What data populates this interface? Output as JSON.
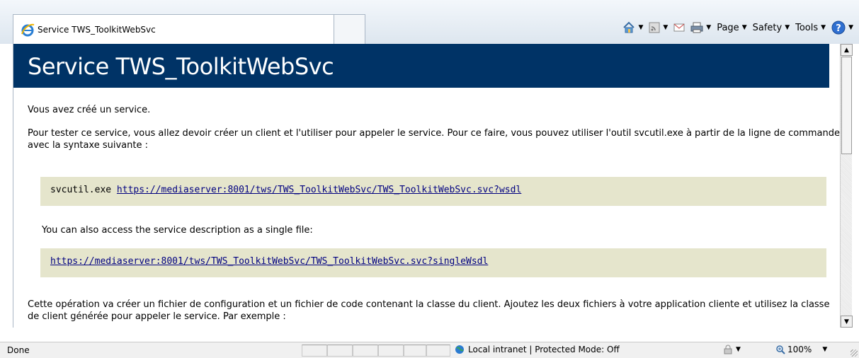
{
  "tab": {
    "title": "Service TWS_ToolkitWebSvc"
  },
  "command_bar": {
    "home_icon": "home-icon",
    "feeds_icon": "feeds-icon",
    "mail_icon": "mail-icon",
    "print_icon": "print-icon",
    "page_label": "Page",
    "safety_label": "Safety",
    "tools_label": "Tools",
    "help_icon": "help-icon"
  },
  "content": {
    "heading": "Service TWS_ToolkitWebSvc",
    "created_text": "Vous avez créé un service.",
    "instructions": "Pour tester ce service, vous allez devoir créer un client et l'utiliser pour appeler le service. Pour ce faire, vous pouvez utiliser l'outil svcutil.exe à partir de la ligne de commande avec la syntaxe suivante :",
    "svcutil_cmd": "svcutil.exe ",
    "wsdl_link": "https://mediaserver:8001/tws/TWS_ToolkitWebSvc/TWS_ToolkitWebSvc.svc?wsdl",
    "single_file_text": "You can also access the service description as a single file:",
    "single_wsdl_link": "https://mediaserver:8001/tws/TWS_ToolkitWebSvc/TWS_ToolkitWebSvc.svc?singleWsdl",
    "config_text": "Cette opération va créer un fichier de configuration et un fichier de code contenant la classe du client. Ajoutez les deux fichiers à votre application cliente et utilisez la classe de client générée pour appeler le service. Par exemple :"
  },
  "status_bar": {
    "status": "Done",
    "zone": "Local intranet | Protected Mode: Off",
    "zoom": "100%"
  },
  "colors": {
    "banner": "#003366",
    "code_bg": "#e5e5cc",
    "link": "#000080"
  }
}
